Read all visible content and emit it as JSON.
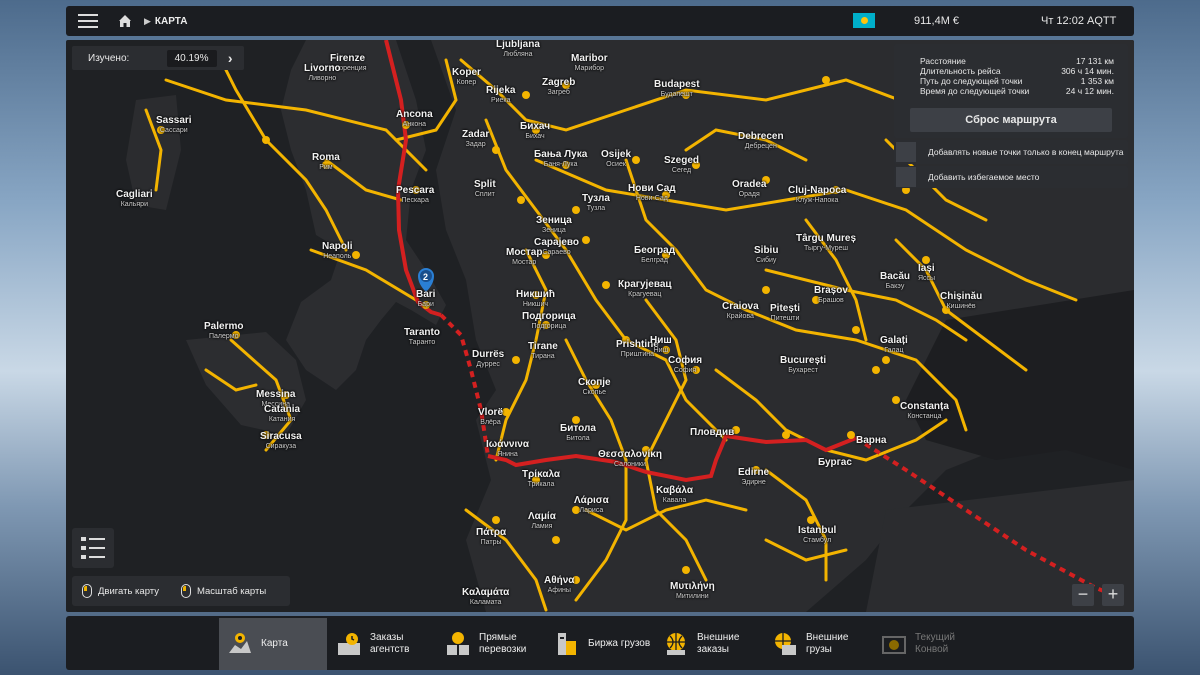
{
  "topbar": {
    "breadcrumb": "КАРТА",
    "money": "911,4M €",
    "clock": "Чт 12:02 AQTT"
  },
  "explored": {
    "label": "Изучено:",
    "value": "40.19%"
  },
  "route_info": {
    "rows": [
      {
        "label": "Расстояние",
        "value": "17 131 км"
      },
      {
        "label": "Длительность рейса",
        "value": "306 ч 14 мин."
      },
      {
        "label": "Путь до следующей точки",
        "value": "1 353 км"
      },
      {
        "label": "Время до следующей точки",
        "value": "24 ч 12 мин."
      }
    ],
    "reset_button": "Сброс маршрута",
    "option_append": "Добавлять новые точки только в конец маршрута",
    "option_avoid": "Добавить избегаемое место"
  },
  "map_hints": {
    "move": "Двигать карту",
    "zoom": "Масштаб карты"
  },
  "waypoint_number": "2",
  "cities": [
    {
      "name": "Ljubljana",
      "local": "Любляна"
    },
    {
      "name": "Maribor",
      "local": "Марибор"
    },
    {
      "name": "Koper",
      "local": "Копер"
    },
    {
      "name": "Rijeka",
      "local": "Риека"
    },
    {
      "name": "Zagreb",
      "local": "Загреб"
    },
    {
      "name": "Budapest",
      "local": "Будапешт"
    },
    {
      "name": "Firenze",
      "local": "Флоренция"
    },
    {
      "name": "Livorno",
      "local": "Ливорно"
    },
    {
      "name": "Ancona",
      "local": "Анкона"
    },
    {
      "name": "Sassari",
      "local": "Сассари"
    },
    {
      "name": "Roma",
      "local": "Рим"
    },
    {
      "name": "Cagliari",
      "local": "Кальяри"
    },
    {
      "name": "Pescara",
      "local": "Пескара"
    },
    {
      "name": "Napoli",
      "local": "Неаполь"
    },
    {
      "name": "Bari",
      "local": "Бари"
    },
    {
      "name": "Taranto",
      "local": "Таранто"
    },
    {
      "name": "Palermo",
      "local": "Палермо"
    },
    {
      "name": "Messina",
      "local": "Мессина"
    },
    {
      "name": "Catania",
      "local": "Катания"
    },
    {
      "name": "Siracusa",
      "local": "Сиракуза"
    },
    {
      "name": "Zadar",
      "local": "Задар"
    },
    {
      "name": "Split",
      "local": "Сплит"
    },
    {
      "name": "Бихач",
      "local": "Бихач"
    },
    {
      "name": "Бања Лука",
      "local": "Баня-Лука"
    },
    {
      "name": "Osijek",
      "local": "Осиек"
    },
    {
      "name": "Szeged",
      "local": "Сегед"
    },
    {
      "name": "Debrecen",
      "local": "Дебрецен"
    },
    {
      "name": "Oradea",
      "local": "Орадя"
    },
    {
      "name": "Cluj-Napoca",
      "local": "Клуж-Напока"
    },
    {
      "name": "Нови Сад",
      "local": "Нови-Сад"
    },
    {
      "name": "Тузла",
      "local": "Тузла"
    },
    {
      "name": "Зеница",
      "local": "Зеница"
    },
    {
      "name": "Сарајево",
      "local": "Сараево"
    },
    {
      "name": "Мостар",
      "local": "Мостар"
    },
    {
      "name": "Београд",
      "local": "Белград"
    },
    {
      "name": "Крагујевац",
      "local": "Крагуевац"
    },
    {
      "name": "Никшић",
      "local": "Никшич"
    },
    {
      "name": "Подгорица",
      "local": "Подгорица"
    },
    {
      "name": "Tirane",
      "local": "Тирана"
    },
    {
      "name": "Prishtinë",
      "local": "Приштина"
    },
    {
      "name": "Ниш",
      "local": "Ниш"
    },
    {
      "name": "София",
      "local": "София"
    },
    {
      "name": "Durrës",
      "local": "Дуррес"
    },
    {
      "name": "Скопје",
      "local": "Скопье"
    },
    {
      "name": "Vlorë",
      "local": "Влёра"
    },
    {
      "name": "Битола",
      "local": "Битола"
    },
    {
      "name": "Ιωάννινα",
      "local": "Янина"
    },
    {
      "name": "Θεσσαλονίκη",
      "local": "Салоники"
    },
    {
      "name": "Καβάλα",
      "local": "Кавала"
    },
    {
      "name": "Τρίκαλα",
      "local": "Трикала"
    },
    {
      "name": "Λάρισα",
      "local": "Лариса"
    },
    {
      "name": "Λαμία",
      "local": "Ламия"
    },
    {
      "name": "Πάτρα",
      "local": "Патры"
    },
    {
      "name": "Αθήνα",
      "local": "Афины"
    },
    {
      "name": "Καλαμάτα",
      "local": "Каламата"
    },
    {
      "name": "Μυτιλήνη",
      "local": "Митилини"
    },
    {
      "name": "Пловдив",
      "local": ""
    },
    {
      "name": "Edirne",
      "local": "Эдирне"
    },
    {
      "name": "Istanbul",
      "local": "Стамбул"
    },
    {
      "name": "Бургас",
      "local": ""
    },
    {
      "name": "Варна",
      "local": ""
    },
    {
      "name": "București",
      "local": "Бухарест"
    },
    {
      "name": "Constanța",
      "local": "Констанца"
    },
    {
      "name": "Brașov",
      "local": "Брашов"
    },
    {
      "name": "Sibiu",
      "local": "Сибиу"
    },
    {
      "name": "Târgu Mureș",
      "local": "Тыргу-Муреш"
    },
    {
      "name": "Bacău",
      "local": "Бакэу"
    },
    {
      "name": "Iași",
      "local": "Яссы"
    },
    {
      "name": "Chișinău",
      "local": "Кишинёв"
    },
    {
      "name": "Galați",
      "local": "Галац"
    },
    {
      "name": "Craiova",
      "local": "Крайова"
    },
    {
      "name": "Pitești",
      "local": "Питешти"
    }
  ],
  "nav": [
    {
      "label": "Карта",
      "icon": "map-icon"
    },
    {
      "label": "Заказы агентств",
      "icon": "agency-icon"
    },
    {
      "label": "Прямые перевозки",
      "icon": "direct-delivery-icon"
    },
    {
      "label": "Биржа грузов",
      "icon": "freight-market-icon"
    },
    {
      "label": "Внешние заказы",
      "icon": "external-contracts-icon"
    },
    {
      "label": "Внешние грузы",
      "icon": "external-cargo-icon"
    },
    {
      "label": "Текущий Конвой",
      "icon": "convoy-icon"
    }
  ],
  "colors": {
    "road": "#f3b400",
    "route": "#d42020",
    "land": "#2b2c2f",
    "sea": "#1e1f22"
  }
}
